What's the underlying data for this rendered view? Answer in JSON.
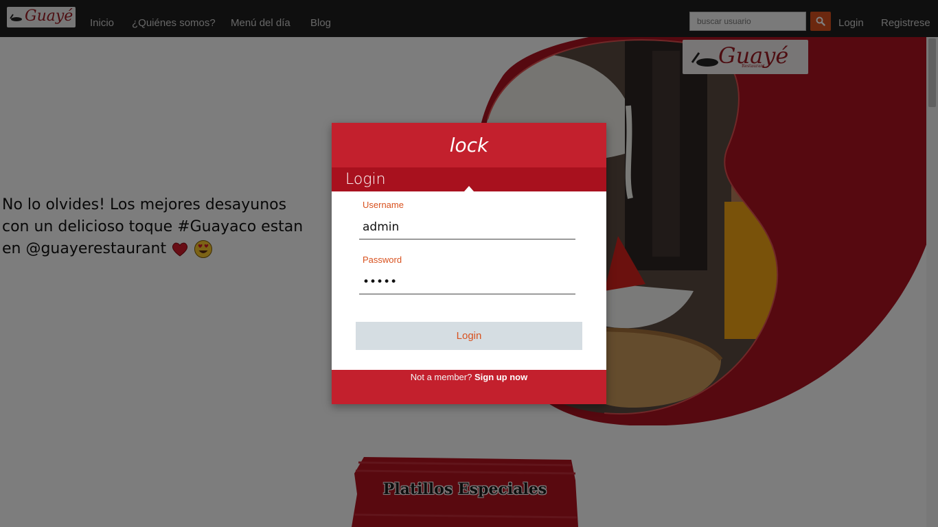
{
  "navbar": {
    "brand": "Guayé",
    "links": [
      "Inicio",
      "¿Quiénes somos?",
      "Menú del día",
      "Blog"
    ],
    "search": {
      "placeholder": "buscar usuario",
      "icon": "search-icon"
    },
    "login": "Login",
    "register": "Registrese"
  },
  "hero": {
    "promo_text": "No lo olvides! Los mejores desayunos con un delicioso toque #Guayaco estan en @guayerestaurant",
    "logo": "Guayé",
    "logo_sub": "Restaurant"
  },
  "specials": {
    "title": "Platillos Especiales"
  },
  "modal": {
    "title": "lock",
    "subtitle": "Login",
    "username": {
      "label": "Username",
      "value": "admin"
    },
    "password": {
      "label": "Password",
      "value": "•••••"
    },
    "submit": "Login",
    "footer_prompt": "Not a member?",
    "footer_link": "Sign up now"
  },
  "colors": {
    "navbar": "#1e1e1e",
    "accent": "#d8511e",
    "brand_red": "#c3202d",
    "dark_red": "#a8111e"
  }
}
